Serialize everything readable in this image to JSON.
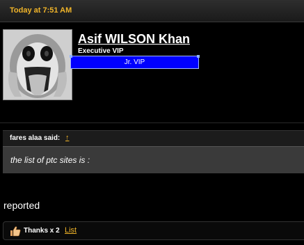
{
  "post": {
    "timestamp": "Today at 7:51 AM"
  },
  "user": {
    "name": "Asif WILSON Khan",
    "title": "Executive VIP",
    "rank": "Jr. VIP",
    "rank_color": "#0000ff"
  },
  "quote": {
    "author_line": "fares alaa said:",
    "arrow": "↑",
    "text": "the list of ptc sites is :"
  },
  "message": {
    "text": "reported"
  },
  "thanks": {
    "label": "Thanks x 2",
    "list_link": "List"
  },
  "colors": {
    "accent": "#f0b429",
    "background": "#000000"
  }
}
